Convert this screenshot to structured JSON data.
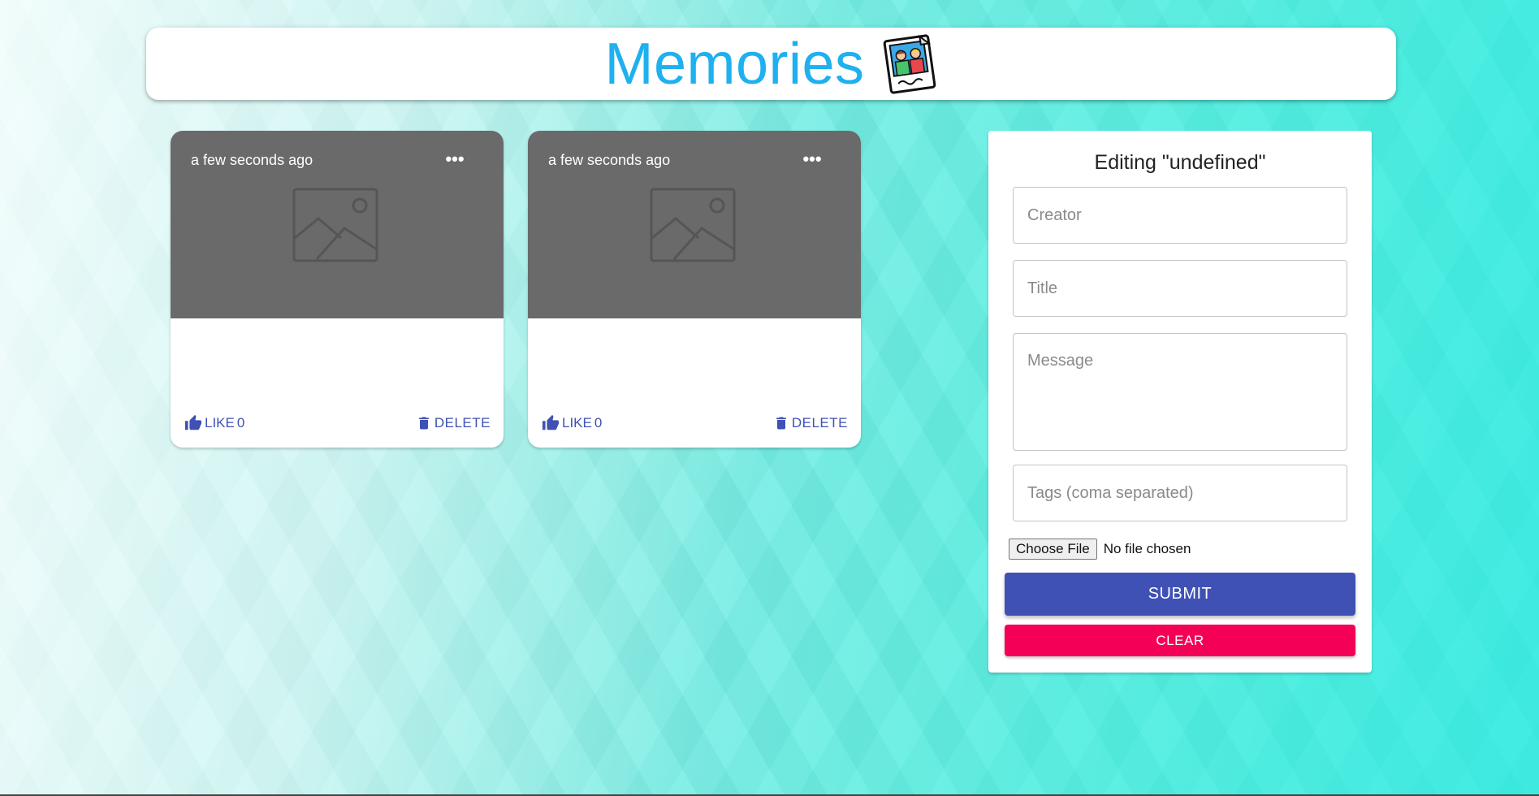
{
  "header": {
    "title": "Memories",
    "logo_icon": "photo-frame-icon"
  },
  "posts": [
    {
      "time": "a few seconds ago",
      "more_label": "•••",
      "like_label": "LIKE",
      "like_count": "0",
      "delete_label": "DELETE"
    },
    {
      "time": "a few seconds ago",
      "more_label": "•••",
      "like_label": "LIKE",
      "like_count": "0",
      "delete_label": "DELETE"
    }
  ],
  "form": {
    "title": "Editing \"undefined\"",
    "creator_placeholder": "Creator",
    "title_placeholder": "Title",
    "message_placeholder": "Message",
    "tags_placeholder": "Tags (coma separated)",
    "file_button": "Choose File",
    "file_status": "No file chosen",
    "submit_label": "SUBMIT",
    "clear_label": "CLEAR"
  },
  "colors": {
    "title": "#1eb0ef",
    "primary": "#3f51b5",
    "secondary": "#f50057",
    "card_media": "#6a6a6a"
  }
}
